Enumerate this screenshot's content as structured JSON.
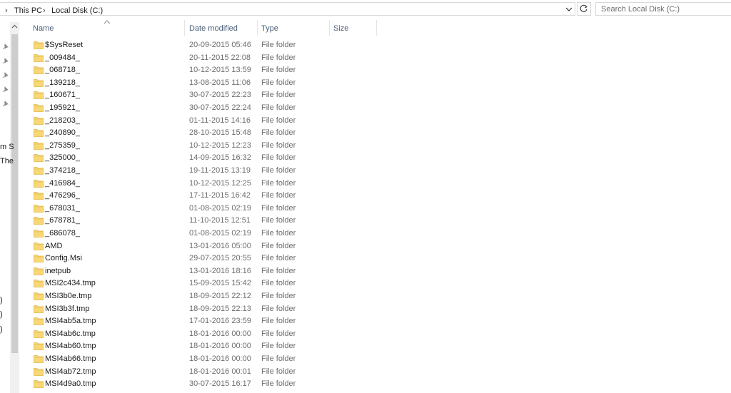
{
  "address_bar": {
    "breadcrumbs": [
      "This PC",
      "Local Disk (C:)"
    ],
    "separator": "›",
    "dropdown_icon": "chevron-down-icon",
    "refresh_icon": "refresh-icon"
  },
  "search": {
    "placeholder": "Search Local Disk (C:)"
  },
  "nav_pane": {
    "fragments": [
      "m S",
      "The",
      ")",
      ")",
      ")"
    ]
  },
  "columns": {
    "name": "Name",
    "date_modified": "Date modified",
    "type": "Type",
    "size": "Size"
  },
  "colors": {
    "folder": "#f8d775",
    "folder_dark": "#e0b84a",
    "header_text": "#4c607a",
    "muted_text": "#6d6d6d"
  },
  "files": [
    {
      "name": "$SysReset",
      "date": "20-09-2015 05:46",
      "type": "File folder"
    },
    {
      "name": "_009484_",
      "date": "20-11-2015 22:08",
      "type": "File folder"
    },
    {
      "name": "_068718_",
      "date": "10-12-2015 13:59",
      "type": "File folder"
    },
    {
      "name": "_139218_",
      "date": "13-08-2015 11:06",
      "type": "File folder"
    },
    {
      "name": "_160671_",
      "date": "30-07-2015 22:23",
      "type": "File folder"
    },
    {
      "name": "_195921_",
      "date": "30-07-2015 22:24",
      "type": "File folder"
    },
    {
      "name": "_218203_",
      "date": "01-11-2015 14:16",
      "type": "File folder"
    },
    {
      "name": "_240890_",
      "date": "28-10-2015 15:48",
      "type": "File folder"
    },
    {
      "name": "_275359_",
      "date": "10-12-2015 12:23",
      "type": "File folder"
    },
    {
      "name": "_325000_",
      "date": "14-09-2015 16:32",
      "type": "File folder"
    },
    {
      "name": "_374218_",
      "date": "19-11-2015 13:19",
      "type": "File folder"
    },
    {
      "name": "_416984_",
      "date": "10-12-2015 12:25",
      "type": "File folder"
    },
    {
      "name": "_476296_",
      "date": "17-11-2015 16:42",
      "type": "File folder"
    },
    {
      "name": "_678031_",
      "date": "01-08-2015 02:19",
      "type": "File folder"
    },
    {
      "name": "_678781_",
      "date": "11-10-2015 12:51",
      "type": "File folder"
    },
    {
      "name": "_686078_",
      "date": "01-08-2015 02:19",
      "type": "File folder"
    },
    {
      "name": "AMD",
      "date": "13-01-2016 05:00",
      "type": "File folder"
    },
    {
      "name": "Config.Msi",
      "date": "29-07-2015 20:55",
      "type": "File folder"
    },
    {
      "name": "inetpub",
      "date": "13-01-2016 18:16",
      "type": "File folder"
    },
    {
      "name": "MSI2c434.tmp",
      "date": "15-09-2015 15:42",
      "type": "File folder"
    },
    {
      "name": "MSI3b0e.tmp",
      "date": "18-09-2015 22:12",
      "type": "File folder"
    },
    {
      "name": "MSI3b3f.tmp",
      "date": "18-09-2015 22:13",
      "type": "File folder"
    },
    {
      "name": "MSI4ab5a.tmp",
      "date": "17-01-2016 23:59",
      "type": "File folder"
    },
    {
      "name": "MSI4ab6c.tmp",
      "date": "18-01-2016 00:00",
      "type": "File folder"
    },
    {
      "name": "MSI4ab60.tmp",
      "date": "18-01-2016 00:00",
      "type": "File folder"
    },
    {
      "name": "MSI4ab66.tmp",
      "date": "18-01-2016 00:00",
      "type": "File folder"
    },
    {
      "name": "MSI4ab72.tmp",
      "date": "18-01-2016 00:01",
      "type": "File folder"
    },
    {
      "name": "MSI4d9a0.tmp",
      "date": "30-07-2015 16:17",
      "type": "File folder"
    }
  ]
}
